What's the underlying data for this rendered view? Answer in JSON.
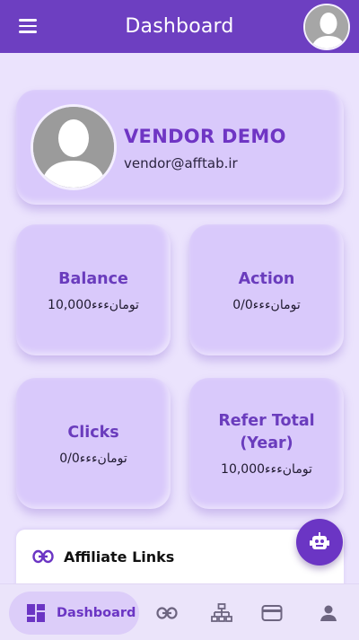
{
  "appbar": {
    "title": "Dashboard",
    "menu_icon": "menu-icon",
    "avatar_icon": "user-avatar"
  },
  "profile": {
    "name": "VENDOR DEMO",
    "email": "vendor@afftab.ir"
  },
  "stats": [
    {
      "title": "Balance",
      "value": "10,000تومانءءء"
    },
    {
      "title": "Action",
      "value": "0/0تومانءءء"
    },
    {
      "title": "Clicks",
      "value": "0/0تومانءءء"
    },
    {
      "title": "Refer Total (Year)",
      "value": "10,000تومانءءء"
    }
  ],
  "affiliate": {
    "title": "Affiliate Links",
    "icon": "link-icon"
  },
  "fab": {
    "icon": "robot-icon"
  },
  "bottom_nav": {
    "active_label": "Dashboard",
    "items": [
      "dashboard-icon",
      "link-icon",
      "sitemap-icon",
      "wallet-icon",
      "user-icon"
    ]
  },
  "colors": {
    "primary": "#6d3fc1",
    "card": "#d9c9fb",
    "background": "#ebe3fd",
    "accent_text": "#6a3cbd"
  }
}
